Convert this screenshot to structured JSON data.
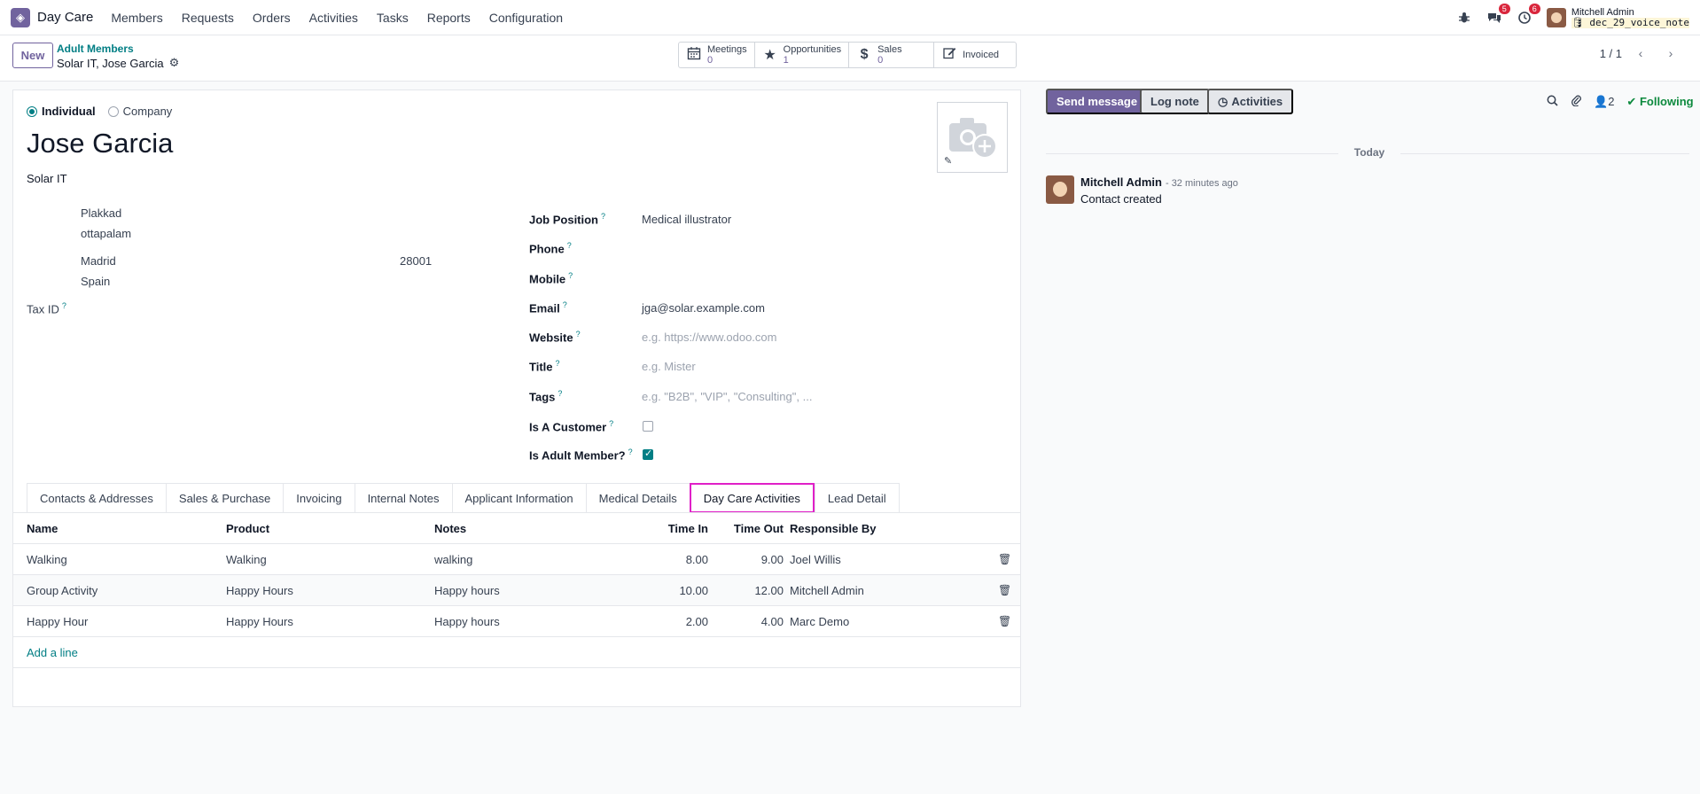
{
  "app": {
    "name": "Day Care",
    "menu": [
      "Members",
      "Requests",
      "Orders",
      "Activities",
      "Tasks",
      "Reports",
      "Configuration"
    ],
    "chat_badge": "5",
    "activity_badge": "6",
    "user_name": "Mitchell Admin",
    "db_name": "dec_29_voice_note"
  },
  "control": {
    "new_label": "New",
    "breadcrumb_parent": "Adult Members",
    "breadcrumb_current": "Solar IT, Jose Garcia",
    "smart_buttons": [
      {
        "label": "Meetings",
        "value": "0",
        "icon": "calendar-icon"
      },
      {
        "label": "Opportunities",
        "value": "1",
        "icon": "star-icon"
      },
      {
        "label": "Sales",
        "value": "0",
        "icon": "dollar-icon"
      },
      {
        "label": "Invoiced",
        "value": "",
        "icon": "edit-icon"
      }
    ],
    "pager": "1 / 1"
  },
  "form": {
    "type_individual": "Individual",
    "type_company": "Company",
    "name": "Jose Garcia",
    "company": "Solar IT",
    "address": {
      "street": "Plakkad",
      "street2": "ottapalam",
      "city": "Madrid",
      "zip": "28001",
      "country": "Spain"
    },
    "tax_id_label": "Tax ID",
    "fields": {
      "job_position": {
        "label": "Job Position",
        "value": "Medical illustrator"
      },
      "phone": {
        "label": "Phone",
        "value": ""
      },
      "mobile": {
        "label": "Mobile",
        "value": ""
      },
      "email": {
        "label": "Email",
        "value": "jga@solar.example.com"
      },
      "website": {
        "label": "Website",
        "placeholder": "e.g. https://www.odoo.com"
      },
      "title": {
        "label": "Title",
        "placeholder": "e.g. Mister"
      },
      "tags": {
        "label": "Tags",
        "placeholder": "e.g. \"B2B\", \"VIP\", \"Consulting\", ..."
      },
      "is_customer": {
        "label": "Is A Customer",
        "checked": false
      },
      "is_adult_member": {
        "label": "Is Adult Member?",
        "checked": true
      }
    },
    "help_mark": "?"
  },
  "tabs": [
    "Contacts & Addresses",
    "Sales & Purchase",
    "Invoicing",
    "Internal Notes",
    "Applicant Information",
    "Medical Details",
    "Day Care Activities",
    "Lead Detail"
  ],
  "active_tab": "Day Care Activities",
  "activities_table": {
    "headers": {
      "name": "Name",
      "product": "Product",
      "notes": "Notes",
      "time_in": "Time In",
      "time_out": "Time Out",
      "responsible": "Responsible By"
    },
    "rows": [
      {
        "name": "Walking",
        "product": "Walking",
        "notes": "walking",
        "time_in": "8.00",
        "time_out": "9.00",
        "responsible": "Joel Willis"
      },
      {
        "name": "Group Activity",
        "product": "Happy Hours",
        "notes": "Happy hours",
        "time_in": "10.00",
        "time_out": "12.00",
        "responsible": "Mitchell Admin"
      },
      {
        "name": "Happy Hour",
        "product": "Happy Hours",
        "notes": "Happy hours",
        "time_in": "2.00",
        "time_out": "4.00",
        "responsible": "Marc Demo"
      }
    ],
    "add_line": "Add a line"
  },
  "chatter": {
    "send_message": "Send message",
    "log_note": "Log note",
    "activities": "Activities",
    "followers_count": "2",
    "following": "Following",
    "date_separator": "Today",
    "message": {
      "author": "Mitchell Admin",
      "time": "- 32 minutes ago",
      "body": "Contact created"
    }
  },
  "colors": {
    "brand": "#71639e",
    "link": "#017e84",
    "highlight": "#e020c8",
    "badge": "#d9263c",
    "following": "#0d8a3e"
  }
}
